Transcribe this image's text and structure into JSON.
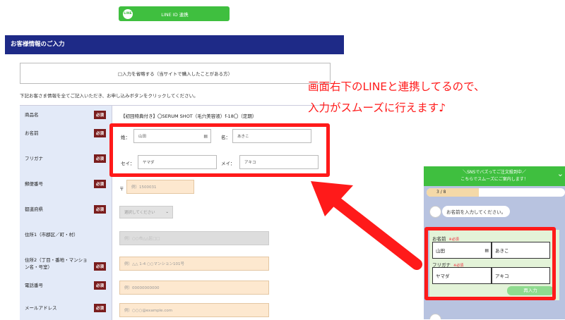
{
  "line_button": {
    "icon": "LINE",
    "label": "LINE ID 連携",
    "color": "#3fbf3f"
  },
  "section": {
    "title": "お客様情報のご入力",
    "color": "#1e2a87"
  },
  "skip_option": "□入力を省略する（当サイトで購入したことがある方）",
  "instruction": "下記お客さま情報を全てご記入いただき、お申し込みボタンをクリックしてください。",
  "required_label": "必須",
  "rows": {
    "product": {
      "label": "商品名",
      "value": "【初回特典付き】〇SERUM SHOT（毛穴美容液）f-18〇（定期）"
    },
    "name": {
      "label": "お名前",
      "sei_label": "姓：",
      "sei_value": "山田",
      "mei_label": "名：",
      "mei_value": "あきこ"
    },
    "kana": {
      "label": "フリガナ",
      "sei_label": "セイ：",
      "sei_value": "ヤマダ",
      "mei_label": "メイ：",
      "mei_value": "アキコ"
    },
    "zip": {
      "label": "郵便番号",
      "prefix": "〒",
      "placeholder": "例）1500031"
    },
    "pref": {
      "label": "都道府県",
      "placeholder": "選択してください"
    },
    "addr1": {
      "label": "住所1（市郡区／町・村）",
      "placeholder": "例）○○市△△区□□"
    },
    "addr2": {
      "label": "住所2（丁目・番地・マンション名・号室）",
      "placeholder": "例）△△ 1-4 ○○マンション101号"
    },
    "tel": {
      "label": "電話番号",
      "placeholder": "例）00000000000"
    },
    "email": {
      "label": "メールアドレス",
      "placeholder": "例）○○○@example.com"
    }
  },
  "annotation": {
    "line1": "画面右下のLINEと連携してるので、",
    "line2": "入力がスムーズに行えます♪",
    "color": "#ff1a1a"
  },
  "chat": {
    "header_line1": "＼SNSでバズってご注文殺到中／",
    "header_line2": "こちらでスムーズにご案内します！",
    "progress_label": "3 / 8",
    "progress": 0.375,
    "bubble": "お名前を入力してください。",
    "name_label": "お名前",
    "name_req": "※必須",
    "name_sei": "山田",
    "name_mei": "あきこ",
    "kana_label": "フリガナ",
    "kana_req": "※必須",
    "kana_sei": "ヤマダ",
    "kana_mei": "アキコ",
    "submit": "再入力"
  }
}
